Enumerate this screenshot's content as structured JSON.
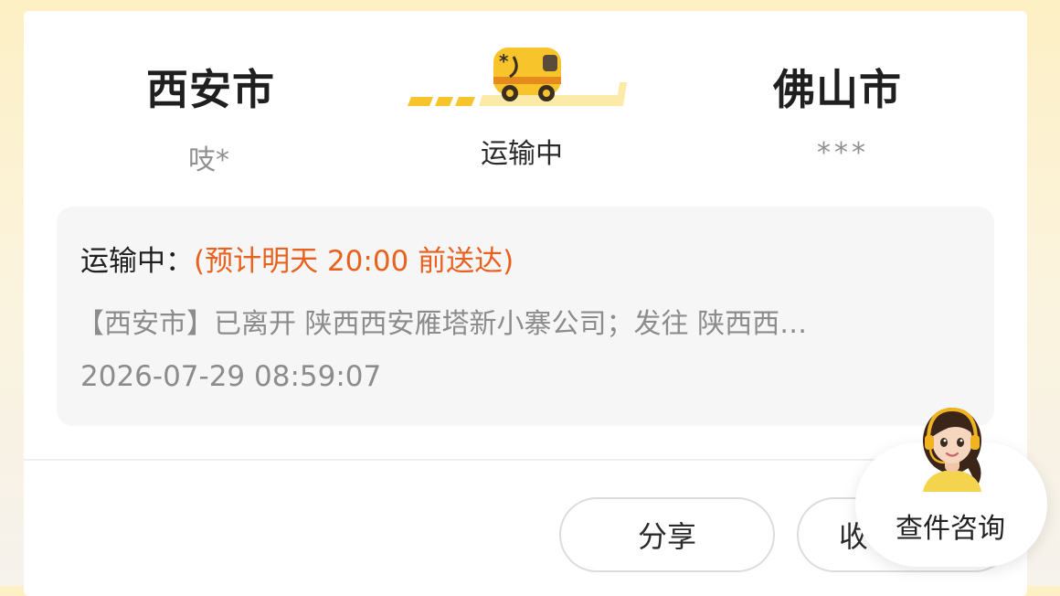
{
  "route": {
    "from_city": "西安市",
    "from_sender": "吱*",
    "to_city": "佛山市",
    "to_receiver": "***",
    "status": "运输中"
  },
  "tracking": {
    "status_prefix": "运输中：",
    "eta": "(预计明天 20:00 前送达)",
    "latest_event": "【西安市】已离开 陕西西安雁塔新小寨公司；发往 陕西西…",
    "latest_time": "2026-07-29 08:59:07"
  },
  "actions": {
    "share_label": "分享",
    "collect_label": "收"
  },
  "assistant": {
    "label": "查件咨询",
    "icon": "customer-service-avatar"
  },
  "colors": {
    "accent_orange": "#e9611e",
    "truck_yellow": "#f7c52b"
  }
}
